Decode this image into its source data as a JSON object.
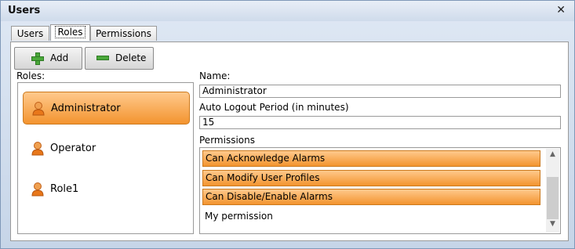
{
  "window": {
    "title": "Users",
    "close_glyph": "✕"
  },
  "tabs": [
    {
      "label": "Users"
    },
    {
      "label": "Roles"
    },
    {
      "label": "Permissions"
    }
  ],
  "toolbar": {
    "add_label": "Add",
    "delete_label": "Delete"
  },
  "roles_label": "Roles:",
  "roles": [
    {
      "name": "Administrator",
      "selected": true
    },
    {
      "name": "Operator",
      "selected": false
    },
    {
      "name": "Role1",
      "selected": false
    }
  ],
  "details": {
    "name_label": "Name:",
    "name_value": "Administrator",
    "logout_label": "Auto Logout Period (in minutes)",
    "logout_value": "15",
    "permissions_label": "Permissions"
  },
  "permissions": [
    {
      "label": "Can Acknowledge Alarms",
      "checked": true
    },
    {
      "label": "Can Modify User Profiles",
      "checked": true
    },
    {
      "label": "Can Disable/Enable Alarms",
      "checked": true
    },
    {
      "label": "My permission",
      "checked": false
    }
  ],
  "colors": {
    "accent": "#f3942f",
    "accent_light": "#ffc98c",
    "add_green": "#4aa83a",
    "person_orange": "#e8771a"
  }
}
